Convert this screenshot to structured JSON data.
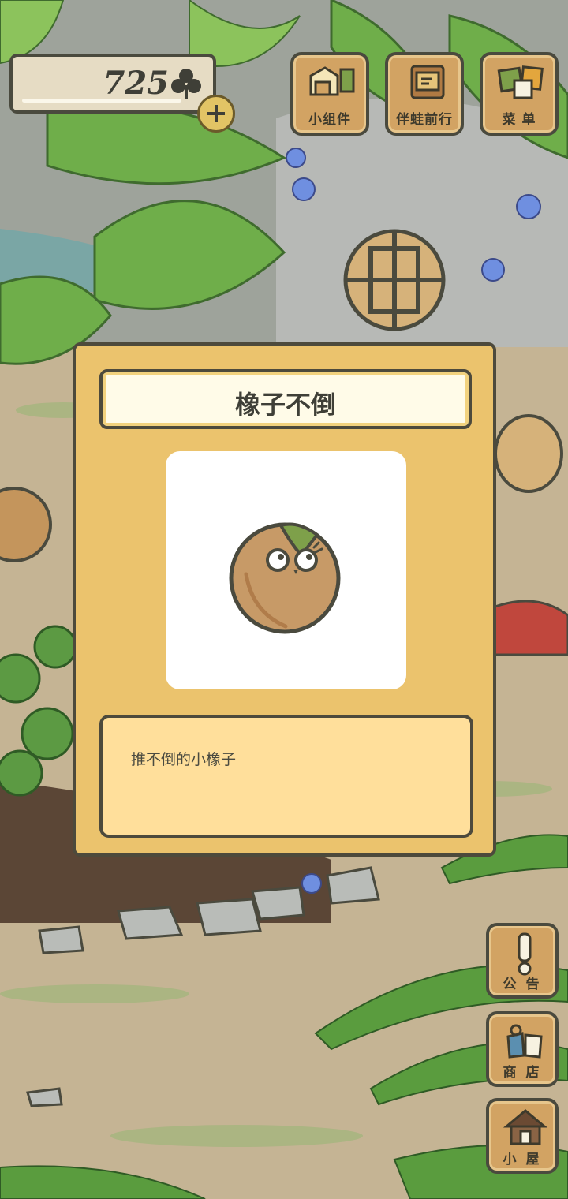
{
  "hud": {
    "clover_count": "725",
    "clover_icon": "clover-icon",
    "add_icon": "plus-icon"
  },
  "top_menu": [
    {
      "label": "小组件",
      "icon": "widget-icon"
    },
    {
      "label": "伴蛙前行",
      "icon": "travel-book-icon"
    },
    {
      "label": "菜 单",
      "icon": "menu-cards-icon"
    }
  ],
  "side_menu": [
    {
      "label": "公 告",
      "icon": "exclamation-icon"
    },
    {
      "label": "商 店",
      "icon": "shop-bags-icon"
    },
    {
      "label": "小 屋",
      "icon": "house-icon"
    }
  ],
  "item_card": {
    "title": "橡子不倒",
    "image_icon": "acorn-doll-icon",
    "description": "推不倒的小橡子"
  },
  "colors": {
    "card_bg": "#ebc36d",
    "title_bg": "#fffbe8",
    "desc_bg": "#ffdf9b",
    "button_wood": "#d2a363",
    "outline": "#4d4a3c"
  }
}
